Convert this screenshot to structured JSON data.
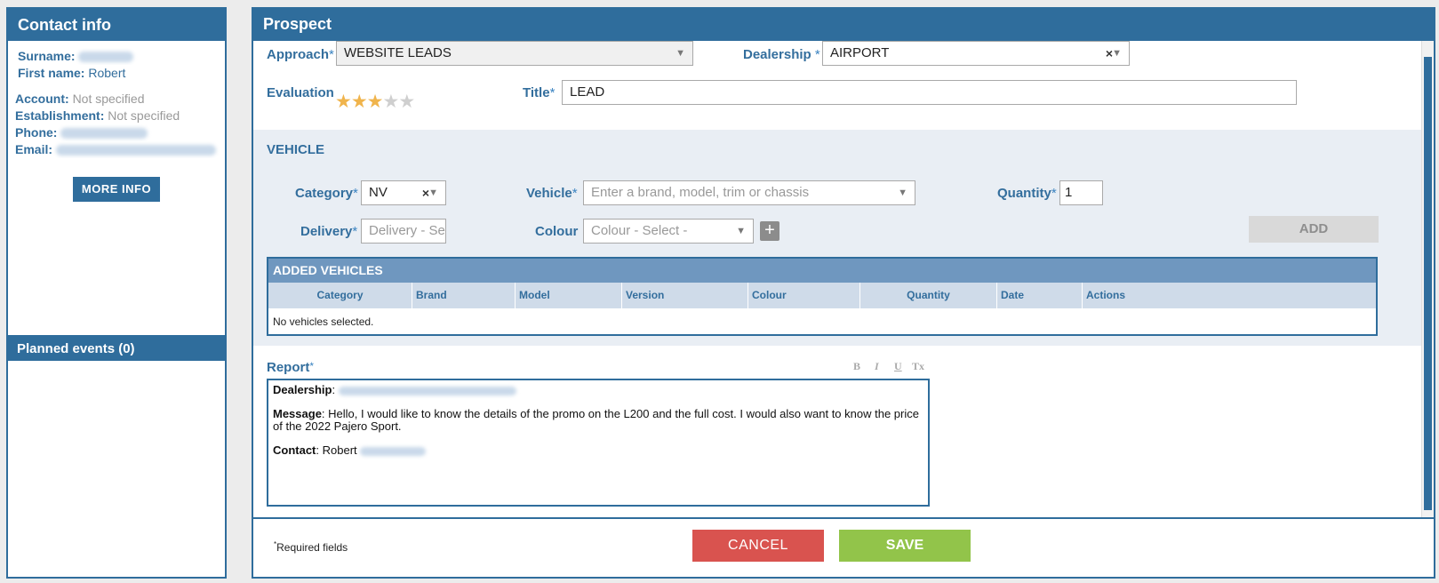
{
  "contact": {
    "title": "Contact info",
    "surname_label": "Surname:",
    "firstname_label": "First name:",
    "firstname_value": "Robert",
    "account_label": "Account:",
    "account_value": "Not specified",
    "establishment_label": "Establishment:",
    "establishment_value": "Not specified",
    "phone_label": "Phone:",
    "email_label": "Email:",
    "more_info": "MORE INFO"
  },
  "events": {
    "title": "Planned events (0)"
  },
  "prospect": {
    "title": "Prospect",
    "approach_label": "Approach",
    "approach_value": "WEBSITE LEADS",
    "dealership_label": "Dealership",
    "dealership_value": "AIRPORT",
    "evaluation_label": "Evaluation",
    "evaluation_rating": 3,
    "evaluation_max": 5,
    "title_label": "Title",
    "title_value": "LEAD",
    "required_mark": "*"
  },
  "vehicle": {
    "section_title": "VEHICLE",
    "category_label": "Category",
    "category_value": "NV",
    "vehicle_label": "Vehicle",
    "vehicle_placeholder": "Enter a brand, model, trim or chassis",
    "quantity_label": "Quantity",
    "quantity_value": "1",
    "delivery_label": "Delivery",
    "delivery_placeholder": "Delivery - Sele",
    "colour_label": "Colour",
    "colour_placeholder": "Colour - Select -",
    "add": "ADD"
  },
  "added_vehicles": {
    "title": "ADDED VEHICLES",
    "columns": [
      "Category",
      "Brand",
      "Model",
      "Version",
      "Colour",
      "Quantity",
      "Date",
      "Actions"
    ],
    "empty": "No vehicles selected."
  },
  "report": {
    "label": "Report",
    "toolbar": [
      "B",
      "I",
      "U",
      "Tx"
    ],
    "dealership_key": "Dealership",
    "message_key": "Message",
    "message_text": ": Hello, I would like to know the details of the promo on the L200 and the full cost. I would also want to know the price of the 2022 Pajero Sport.",
    "contact_key": "Contact",
    "contact_text": ": Robert"
  },
  "footer": {
    "required_note": "Required fields",
    "cancel": "CANCEL",
    "save": "SAVE"
  },
  "colors": {
    "primary": "#2f6d9c",
    "cancel": "#d9534f",
    "save": "#92c44a",
    "star": "#f0b44c"
  }
}
